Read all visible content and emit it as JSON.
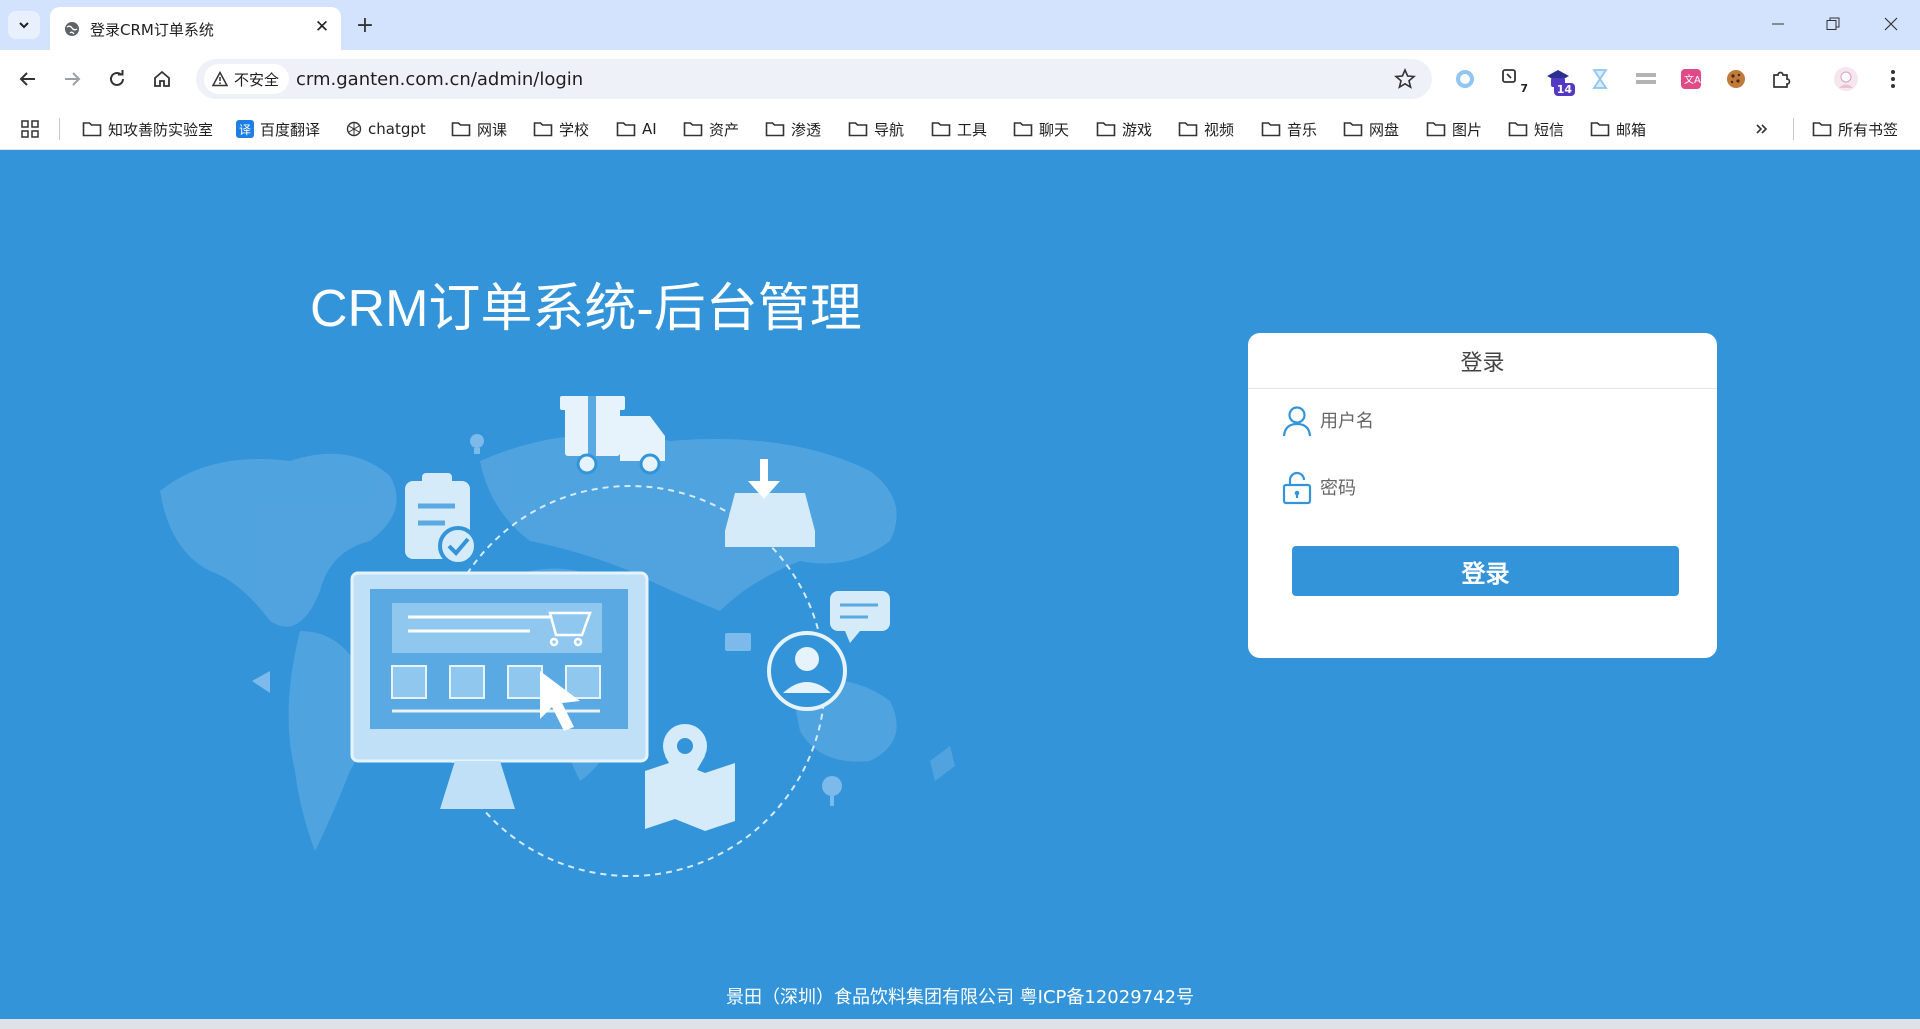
{
  "browser": {
    "tab_title": "登录CRM订单系统",
    "url": "crm.ganten.com.cn/admin/login",
    "security_label": "不安全",
    "extensions": [
      {
        "icon": "circle-extension-icon"
      },
      {
        "icon": "paste-extension-icon",
        "badge": "7"
      },
      {
        "icon": "school-extension-icon",
        "badge": "14"
      },
      {
        "icon": "hourglass-extension-icon"
      },
      {
        "icon": "stripes-extension-icon"
      },
      {
        "icon": "translate-extension-icon"
      },
      {
        "icon": "cookie-extension-icon"
      },
      {
        "icon": "puzzle-extensions-icon"
      }
    ]
  },
  "bookmarks": {
    "items": [
      {
        "label": "知攻善防实验室",
        "icon": "folder-icon"
      },
      {
        "label": "百度翻译",
        "icon": "translate-icon"
      },
      {
        "label": "chatgpt",
        "icon": "openai-icon"
      },
      {
        "label": "网课",
        "icon": "folder-icon"
      },
      {
        "label": "学校",
        "icon": "folder-icon"
      },
      {
        "label": "AI",
        "icon": "folder-icon"
      },
      {
        "label": "资产",
        "icon": "folder-icon"
      },
      {
        "label": "渗透",
        "icon": "folder-icon"
      },
      {
        "label": "导航",
        "icon": "folder-icon"
      },
      {
        "label": "工具",
        "icon": "folder-icon"
      },
      {
        "label": "聊天",
        "icon": "folder-icon"
      },
      {
        "label": "游戏",
        "icon": "folder-icon"
      },
      {
        "label": "视频",
        "icon": "folder-icon"
      },
      {
        "label": "音乐",
        "icon": "folder-icon"
      },
      {
        "label": "网盘",
        "icon": "folder-icon"
      },
      {
        "label": "图片",
        "icon": "folder-icon"
      },
      {
        "label": "短信",
        "icon": "folder-icon"
      },
      {
        "label": "邮箱",
        "icon": "folder-icon"
      }
    ],
    "all_bookmarks_label": "所有书签"
  },
  "page": {
    "title": "CRM订单系统-后台管理",
    "login": {
      "header": "登录",
      "username_placeholder": "用户名",
      "password_placeholder": "密码",
      "submit_label": "登录"
    },
    "footer": "景田（深圳）食品饮料集团有限公司 粤ICP备12029742号"
  },
  "colors": {
    "page_background": "#3394d9",
    "button": "#3394d9",
    "card": "#ffffff"
  }
}
